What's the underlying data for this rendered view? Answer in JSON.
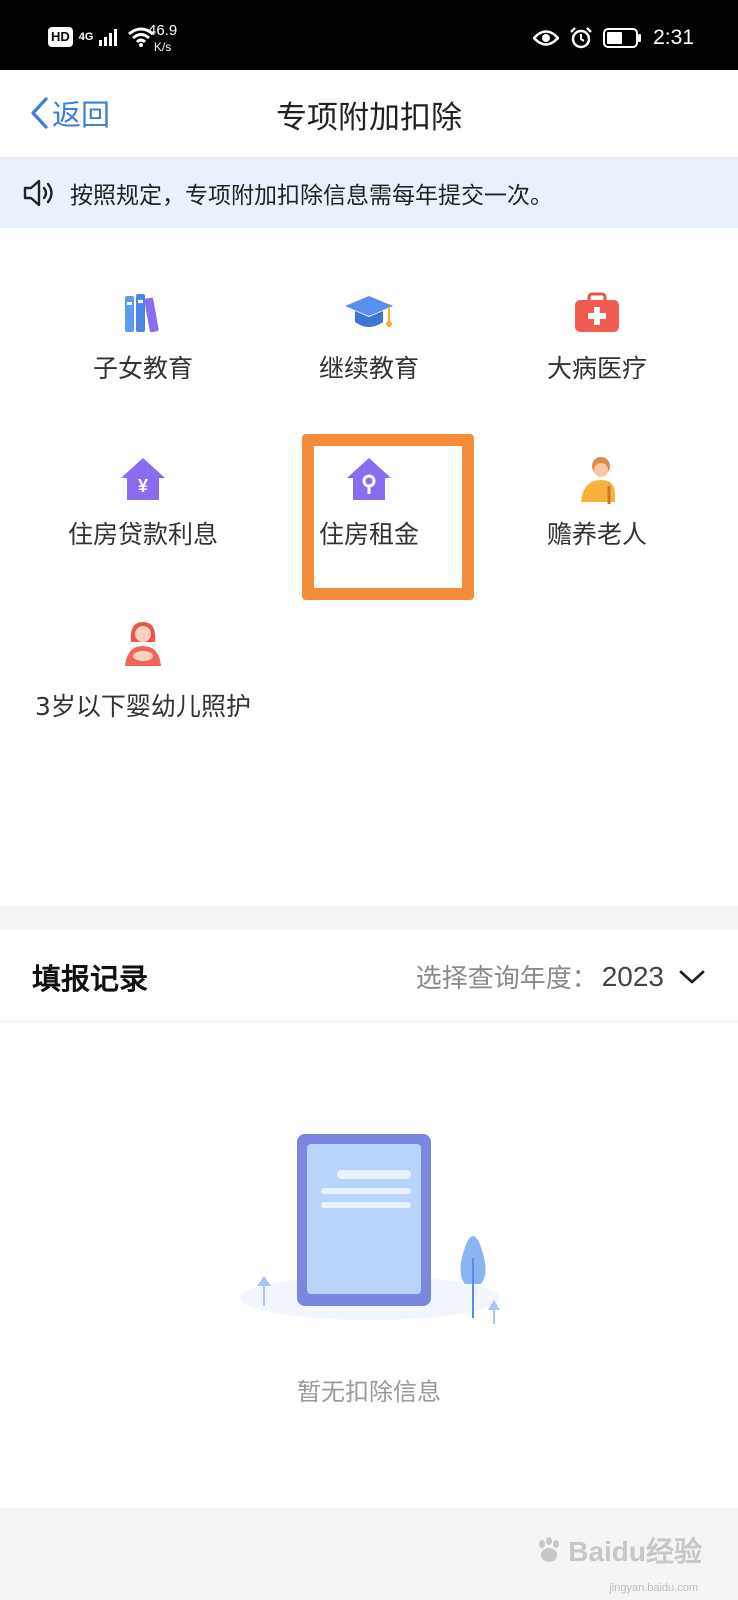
{
  "status_bar": {
    "hd": "HD",
    "network": "4G",
    "speed_value": "46.9",
    "speed_unit": "K/s",
    "time": "2:31"
  },
  "header": {
    "back_label": "返回",
    "title": "专项附加扣除"
  },
  "notice": {
    "text": "按照规定，专项附加扣除信息需每年提交一次。"
  },
  "categories": [
    {
      "label": "子女教育",
      "icon": "books-icon"
    },
    {
      "label": "继续教育",
      "icon": "graduation-cap-icon"
    },
    {
      "label": "大病医疗",
      "icon": "medical-kit-icon"
    },
    {
      "label": "住房贷款利息",
      "icon": "house-loan-icon"
    },
    {
      "label": "住房租金",
      "icon": "house-key-icon"
    },
    {
      "label": "赡养老人",
      "icon": "elderly-icon"
    },
    {
      "label": "3岁以下婴幼儿照护",
      "icon": "mother-baby-icon"
    }
  ],
  "records": {
    "title": "填报记录",
    "year_label": "选择查询年度：",
    "year_value": "2023",
    "empty_text": "暂无扣除信息"
  },
  "watermark": {
    "brand": "Baidu经验",
    "url": "jingyan.baidu.com"
  },
  "colors": {
    "accent_blue": "#3d7fd6",
    "notice_bg": "#e9f2fc",
    "highlight_orange": "#f68b3a",
    "icon_purple": "#8a6cf0"
  }
}
